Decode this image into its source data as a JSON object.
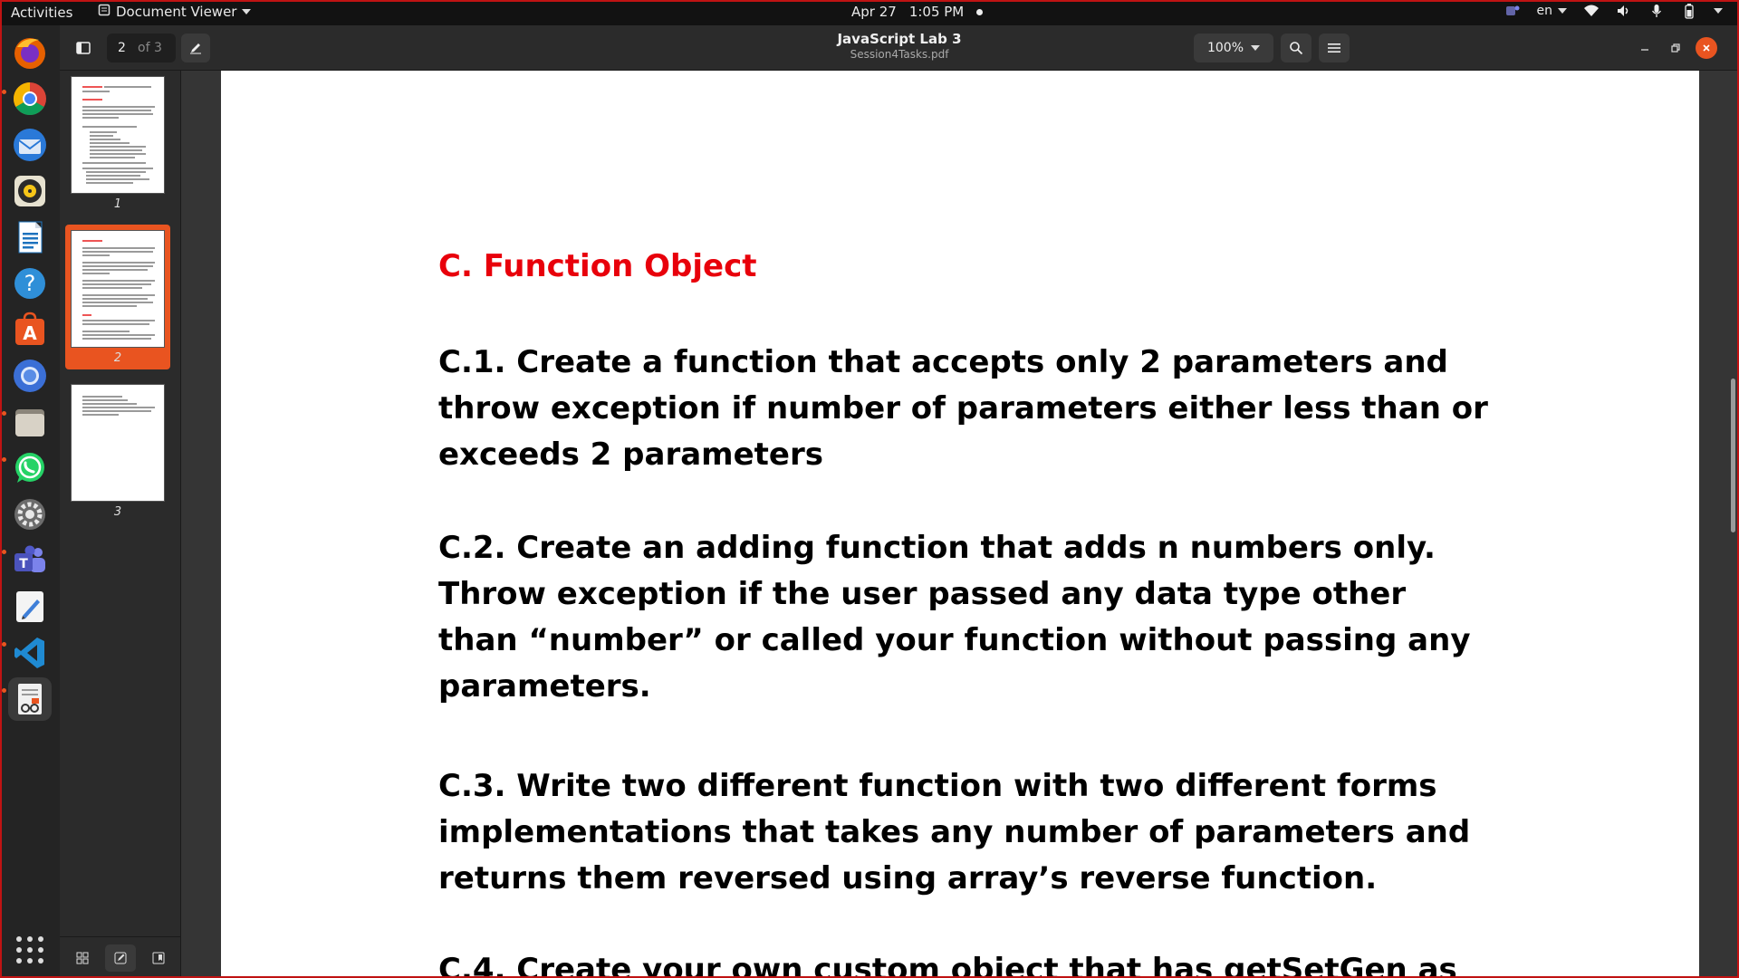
{
  "topbar": {
    "activities": "Activities",
    "app_name": "Document Viewer",
    "date": "Apr 27",
    "time": "1:05 PM",
    "language": "en"
  },
  "dock": {
    "items": [
      {
        "name": "firefox-icon",
        "color": "#e66000"
      },
      {
        "name": "chrome-icon",
        "color": "#4285f4"
      },
      {
        "name": "thunderbird-icon",
        "color": "#2a79d8"
      },
      {
        "name": "rhythmbox-icon",
        "color": "#f5c518"
      },
      {
        "name": "writer-icon",
        "color": "#1e73be"
      },
      {
        "name": "help-icon",
        "color": "#2f8fd8"
      },
      {
        "name": "app-center-icon",
        "color": "#e95420"
      },
      {
        "name": "chromium-icon",
        "color": "#5a8de6"
      },
      {
        "name": "files-icon",
        "color": "#b8b2a8"
      },
      {
        "name": "whatsapp-icon",
        "color": "#25d366"
      },
      {
        "name": "settings-icon",
        "color": "#9a9a9a"
      },
      {
        "name": "teams-icon",
        "color": "#6264a7"
      },
      {
        "name": "text-editor-icon",
        "color": "#3f7fd8"
      },
      {
        "name": "vscode-icon",
        "color": "#1f8ad2"
      },
      {
        "name": "document-viewer-icon",
        "color": "#e0e0e0"
      }
    ]
  },
  "header": {
    "current_page": "2",
    "page_of": "of 3",
    "title": "JavaScript Lab 3",
    "subtitle": "Session4Tasks.pdf",
    "zoom": "100%"
  },
  "sidebar": {
    "thumbs": [
      {
        "num": "1"
      },
      {
        "num": "2"
      },
      {
        "num": "3"
      }
    ]
  },
  "document": {
    "heading": "C. Function Object",
    "paragraphs": [
      "C.1. Create a function that accepts only 2 parameters and throw exception if number of parameters either less than or exceeds 2 parameters",
      "C.2. Create an adding function that adds n numbers only. Throw exception if the user passed any data type other than “number” or called your function without passing any parameters.",
      "C.3. Write two different function with two different forms implementations that takes any number of parameters and returns them reversed using array’s reverse function.",
      "C.4. Create your own custom object that has getSetGen as"
    ]
  },
  "colors": {
    "accent": "#e95420",
    "heading_red": "#e8000b"
  }
}
